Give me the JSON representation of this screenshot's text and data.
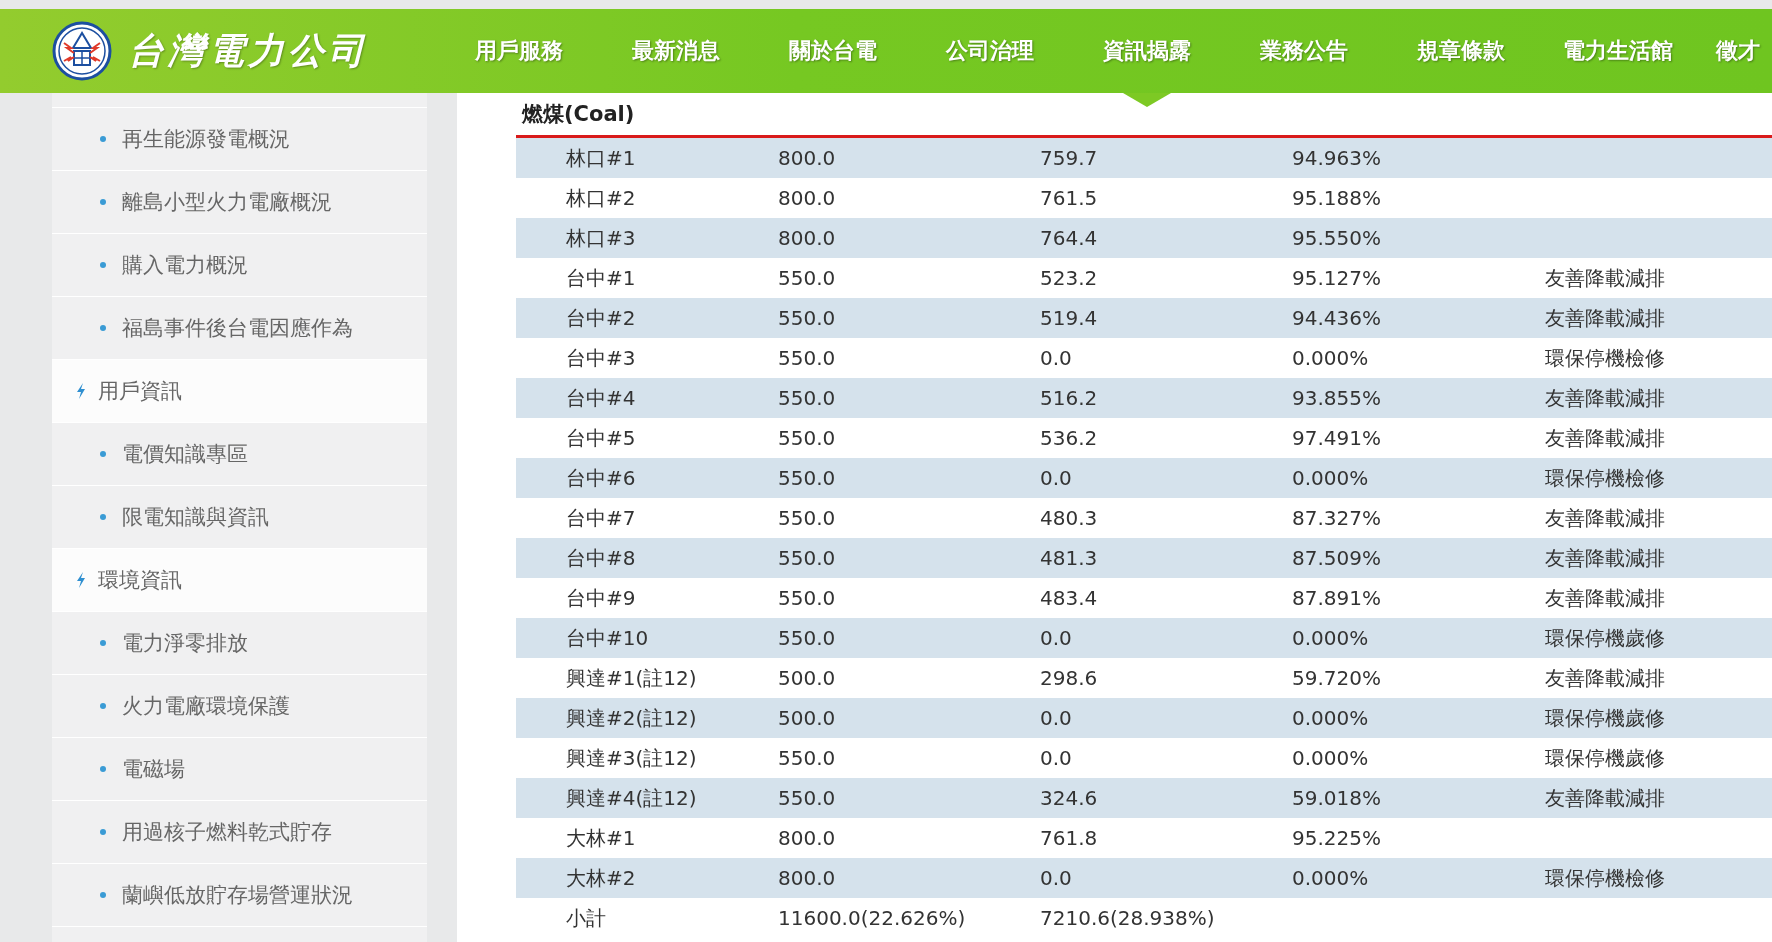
{
  "header": {
    "logo_text": "台灣電力公司",
    "nav": [
      {
        "label": "用戶服務",
        "selected": false
      },
      {
        "label": "最新消息",
        "selected": false
      },
      {
        "label": "關於台電",
        "selected": false
      },
      {
        "label": "公司治理",
        "selected": false
      },
      {
        "label": "資訊揭露",
        "selected": true
      },
      {
        "label": "業務公告",
        "selected": false
      },
      {
        "label": "規章條款",
        "selected": false
      },
      {
        "label": "電力生活館",
        "selected": false
      },
      {
        "label": "徵才",
        "selected": false
      }
    ]
  },
  "sidebar": {
    "items": [
      {
        "kind": "item",
        "label": "再生能源發電概況"
      },
      {
        "kind": "item",
        "label": "離島小型火力電廠概況"
      },
      {
        "kind": "item",
        "label": "購入電力概況"
      },
      {
        "kind": "item",
        "label": "福島事件後台電因應作為"
      },
      {
        "kind": "header",
        "label": "用戶資訊"
      },
      {
        "kind": "item",
        "label": "電價知識專區"
      },
      {
        "kind": "item",
        "label": "限電知識與資訊"
      },
      {
        "kind": "header",
        "label": "環境資訊"
      },
      {
        "kind": "item",
        "label": "電力淨零排放"
      },
      {
        "kind": "item",
        "label": "火力電廠環境保護"
      },
      {
        "kind": "item",
        "label": "電磁場"
      },
      {
        "kind": "item",
        "label": "用過核子燃料乾式貯存"
      },
      {
        "kind": "item",
        "label": "蘭嶼低放貯存場營運狀況"
      }
    ]
  },
  "table": {
    "title": "燃煤(Coal)",
    "rows": [
      [
        "林口#1",
        "800.0",
        "759.7",
        "94.963%",
        ""
      ],
      [
        "林口#2",
        "800.0",
        "761.5",
        "95.188%",
        ""
      ],
      [
        "林口#3",
        "800.0",
        "764.4",
        "95.550%",
        ""
      ],
      [
        "台中#1",
        "550.0",
        "523.2",
        "95.127%",
        "友善降載減排"
      ],
      [
        "台中#2",
        "550.0",
        "519.4",
        "94.436%",
        "友善降載減排"
      ],
      [
        "台中#3",
        "550.0",
        "0.0",
        "0.000%",
        "環保停機檢修"
      ],
      [
        "台中#4",
        "550.0",
        "516.2",
        "93.855%",
        "友善降載減排"
      ],
      [
        "台中#5",
        "550.0",
        "536.2",
        "97.491%",
        "友善降載減排"
      ],
      [
        "台中#6",
        "550.0",
        "0.0",
        "0.000%",
        "環保停機檢修"
      ],
      [
        "台中#7",
        "550.0",
        "480.3",
        "87.327%",
        "友善降載減排"
      ],
      [
        "台中#8",
        "550.0",
        "481.3",
        "87.509%",
        "友善降載減排"
      ],
      [
        "台中#9",
        "550.0",
        "483.4",
        "87.891%",
        "友善降載減排"
      ],
      [
        "台中#10",
        "550.0",
        "0.0",
        "0.000%",
        "環保停機歲修"
      ],
      [
        "興達#1(註12)",
        "500.0",
        "298.6",
        "59.720%",
        "友善降載減排"
      ],
      [
        "興達#2(註12)",
        "500.0",
        "0.0",
        "0.000%",
        "環保停機歲修"
      ],
      [
        "興達#3(註12)",
        "550.0",
        "0.0",
        "0.000%",
        "環保停機歲修"
      ],
      [
        "興達#4(註12)",
        "550.0",
        "324.6",
        "59.018%",
        "友善降載減排"
      ],
      [
        "大林#1",
        "800.0",
        "761.8",
        "95.225%",
        ""
      ],
      [
        "大林#2",
        "800.0",
        "0.0",
        "0.000%",
        "環保停機檢修"
      ],
      [
        "小計",
        "11600.0(22.626%)",
        "7210.6(28.938%)",
        "",
        ""
      ]
    ]
  }
}
